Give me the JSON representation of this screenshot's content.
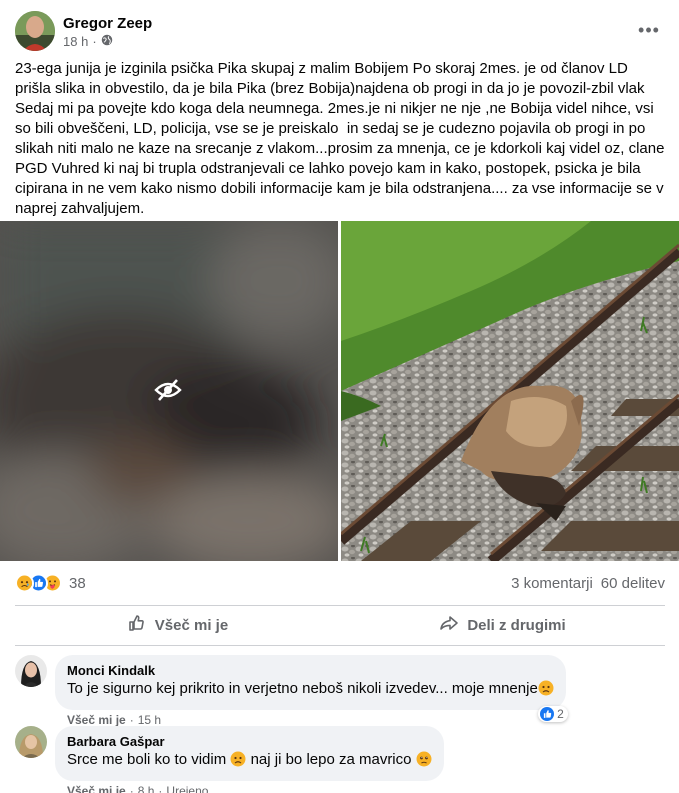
{
  "post": {
    "author": "Gregor Zeep",
    "time": "18 h",
    "privacy_sep": "·",
    "more_icon": "•••",
    "text": "23-ega junija je izginila psička Pika skupaj z malim Bobijem Po skoraj 2mes. je od članov LD prišla slika in obvestilo, da je bila Pika (brez Bobija)najdena ob progi in da jo je povozil-zbil vlak  Sedaj mi pa povejte kdo koga dela neumnega. 2mes.je ni nikjer ne nje ,ne Bobija videl nihce, vsi so bili obveščeni, LD, policija, vse se je preiskalo  in sedaj se je cudezno pojavila ob progi in po slikah niti malo ne kaze na srecanje z vlakom...prosim za mnenja, ce je kdorkoli kaj videl oz, clane PGD Vuhred ki naj bi trupla odstranjevali ce lahko povejo kam in kako, postopek, psicka je bila cipirana in ne vem kako nismo dobili informacije kam je bila odstranjena.... za vse informacije se v naprej zahvaljujem."
  },
  "stats": {
    "reaction_count": "38",
    "comments": "3 komentarji",
    "shares": "60 delitev"
  },
  "actions": {
    "like": "Všeč mi je",
    "share": "Deli z drugimi"
  },
  "comments": [
    {
      "name": "Monci Kindalk",
      "text": "To je sigurno kej prikrito in verjetno neboš nikoli izvedev... moje mnenje",
      "like": "Všeč mi je",
      "sep": "·",
      "time": "15 h",
      "reactions": "2"
    },
    {
      "name": "Barbara Gašpar",
      "text_a": "Srce me boli ko to vidim",
      "text_b": " naj ji bo lepo za mavrico",
      "like": "Všeč mi je",
      "sep1": "·",
      "time": "8 h",
      "sep2": "·",
      "edited": "Urejeno"
    }
  ],
  "icons": {
    "globe": "globe-icon",
    "eye_off": "eye-slash-icon",
    "like": "thumbs-up-icon",
    "share": "share-arrow-icon"
  },
  "colors": {
    "text_secondary": "#65676b",
    "like_blue": "#1877f2",
    "bubble": "#f0f2f5"
  }
}
